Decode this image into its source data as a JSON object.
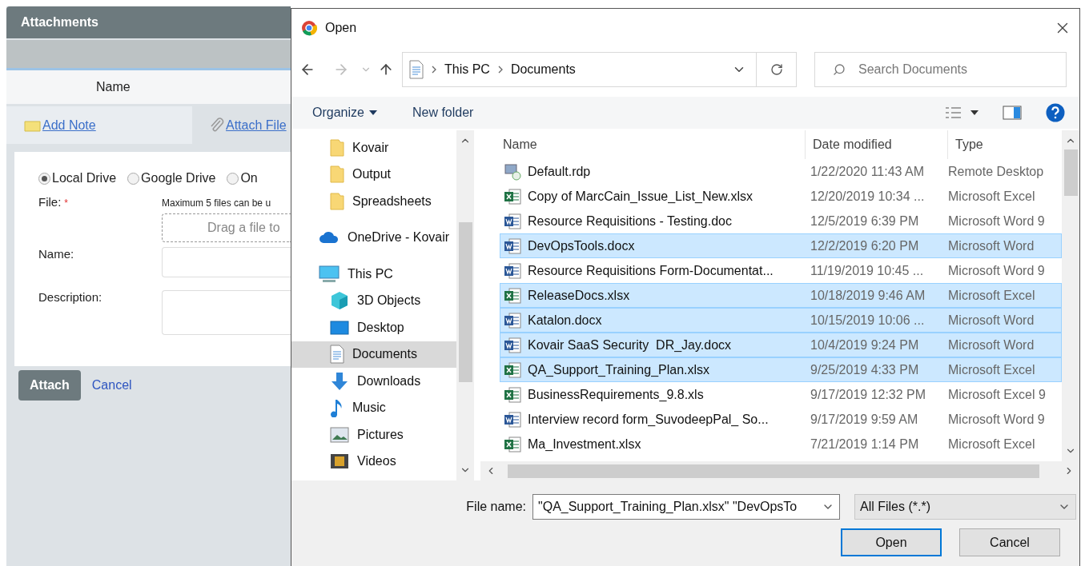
{
  "panel": {
    "title": "Attachments",
    "column_header": "Name",
    "tabs": [
      {
        "label": "Add Note",
        "kind": "note",
        "selected": false
      },
      {
        "label": "Attach File",
        "kind": "clip",
        "selected": true
      }
    ],
    "sources": [
      {
        "label": "Local Drive",
        "selected": true
      },
      {
        "label": "Google Drive",
        "selected": false
      },
      {
        "label": "On",
        "selected": false
      }
    ],
    "file_label": "File:",
    "required_mark": "*",
    "hint": "Maximum 5 files can be u",
    "drop_zone": "Drag a file to",
    "name_label": "Name:",
    "description_label": "Description:",
    "attach_button": "Attach",
    "cancel_link": "Cancel"
  },
  "dialog": {
    "title": "Open",
    "breadcrumb": [
      "This PC",
      "Documents"
    ],
    "search": {
      "placeholder": "Search Documents"
    },
    "toolbar": [
      {
        "label": "Organize",
        "kind": "menu"
      },
      {
        "label": "New folder",
        "kind": "plain"
      }
    ],
    "nav": [
      {
        "label": "Kovair",
        "kind": "folder",
        "selected": false
      },
      {
        "label": "Output",
        "kind": "folder",
        "selected": false
      },
      {
        "label": "Spreadsheets",
        "kind": "folder",
        "selected": false
      },
      {
        "label": "OneDrive - Kovair",
        "kind": "cloud",
        "selected": false
      },
      {
        "label": "This PC",
        "kind": "pc",
        "selected": false,
        "children": [
          {
            "label": "3D Objects",
            "kind": "cube",
            "selected": false
          },
          {
            "label": "Desktop",
            "kind": "desktop",
            "selected": false
          },
          {
            "label": "Documents",
            "kind": "documents",
            "selected": true
          },
          {
            "label": "Downloads",
            "kind": "download",
            "selected": false
          },
          {
            "label": "Music",
            "kind": "music",
            "selected": false
          },
          {
            "label": "Pictures",
            "kind": "pictures",
            "selected": false
          },
          {
            "label": "Videos",
            "kind": "videos",
            "selected": false
          }
        ]
      }
    ],
    "columns": [
      "Name",
      "Date modified",
      "Type"
    ],
    "files": [
      {
        "name": "Default.rdp",
        "date": "1/22/2020 11:43 AM",
        "type": "Remote Desktop",
        "kind": "rdp",
        "selected": false
      },
      {
        "name": "Copy of MarcCain_Issue_List_New.xlsx",
        "date": "12/20/2019 10:34 ...",
        "type": "Microsoft Excel",
        "kind": "excel",
        "selected": false
      },
      {
        "name": "Resource Requisitions - Testing.doc",
        "date": "12/5/2019 6:39 PM",
        "type": "Microsoft Word 9",
        "kind": "word",
        "selected": false
      },
      {
        "name": "DevOpsTools.docx",
        "date": "12/2/2019 6:20 PM",
        "type": "Microsoft Word",
        "kind": "word",
        "selected": true
      },
      {
        "name": "Resource Requisitions Form-Documentat...",
        "date": "11/19/2019 10:45 ...",
        "type": "Microsoft Word 9",
        "kind": "word",
        "selected": false
      },
      {
        "name": "ReleaseDocs.xlsx",
        "date": "10/18/2019 9:46 AM",
        "type": "Microsoft Excel",
        "kind": "excel",
        "selected": true
      },
      {
        "name": "Katalon.docx",
        "date": "10/15/2019 10:06 ...",
        "type": "Microsoft Word",
        "kind": "word",
        "selected": true
      },
      {
        "name": "Kovair SaaS Security  DR_Jay.docx",
        "date": "10/4/2019 9:24 PM",
        "type": "Microsoft Word",
        "kind": "word",
        "selected": true
      },
      {
        "name": "QA_Support_Training_Plan.xlsx",
        "date": "9/25/2019 4:33 PM",
        "type": "Microsoft Excel",
        "kind": "excel",
        "selected": true
      },
      {
        "name": "BusinessRequirements_9.8.xls",
        "date": "9/17/2019 12:32 PM",
        "type": "Microsoft Excel 9",
        "kind": "excel",
        "selected": false
      },
      {
        "name": "Interview record form_SuvodeepPal_ So...",
        "date": "9/17/2019 9:59 AM",
        "type": "Microsoft Word 9",
        "kind": "word",
        "selected": false
      },
      {
        "name": "Ma_Investment.xlsx",
        "date": "7/21/2019 1:14 PM",
        "type": "Microsoft Excel",
        "kind": "excel",
        "selected": false
      }
    ],
    "file_name_label": "File name:",
    "file_name": "\"QA_Support_Training_Plan.xlsx\" \"DevOpsTo",
    "file_type": "All Files (*.*)",
    "buttons": [
      {
        "label": "Open",
        "kind": "default"
      },
      {
        "label": "Cancel",
        "kind": "normal"
      }
    ]
  }
}
